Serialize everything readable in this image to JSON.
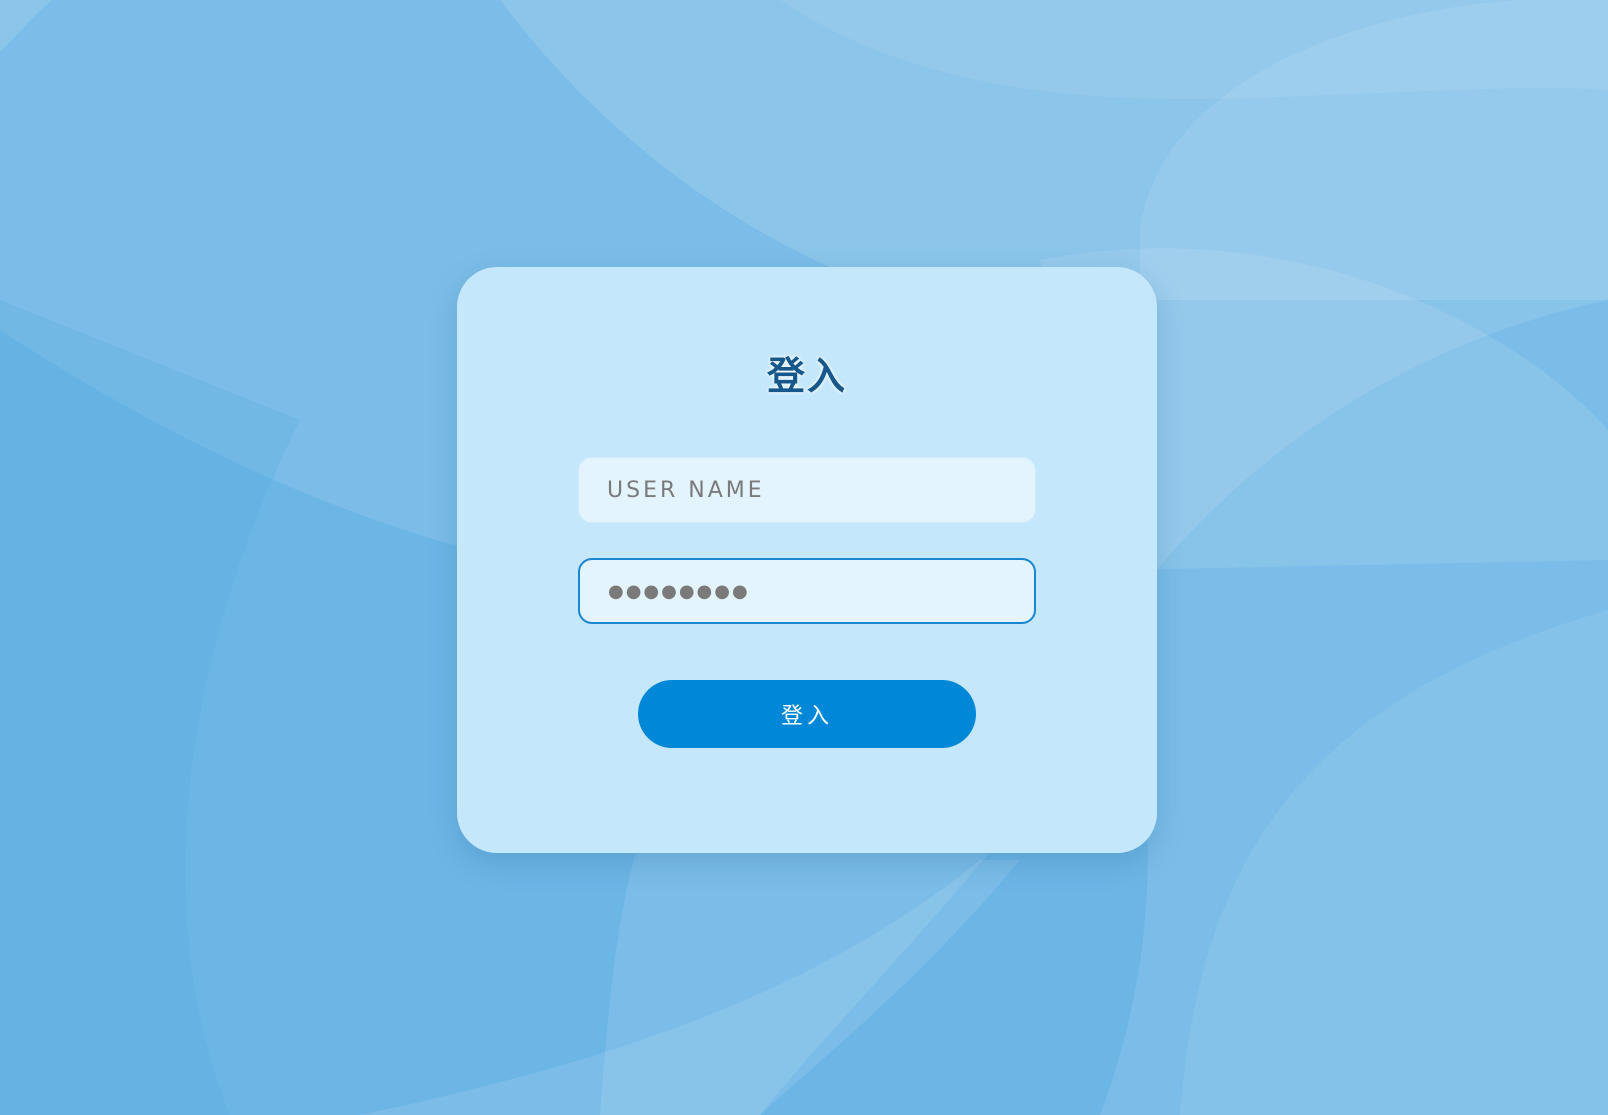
{
  "login": {
    "title": "登入",
    "username": {
      "placeholder": "USER NAME"
    },
    "password": {
      "masked_value": "●●●●●●●●"
    },
    "submit_label": "登入"
  },
  "colors": {
    "background": "#6cb6e6",
    "card": "#c4e7fc",
    "title": "#16588c",
    "field": "#e4f4fe",
    "focus_border": "#1a85d0",
    "button": "#0087d8"
  }
}
